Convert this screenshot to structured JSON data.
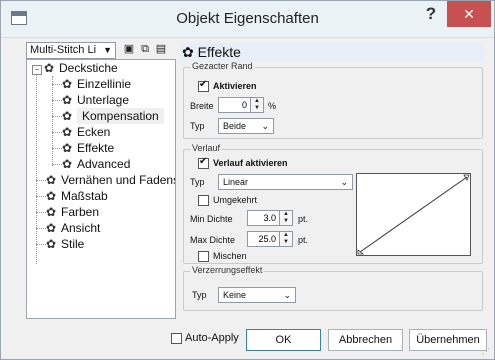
{
  "window": {
    "title": "Objekt Eigenschaften",
    "help_label": "?",
    "close_label": "✕"
  },
  "left": {
    "combo": {
      "value": "Multi-Stitch Li"
    },
    "toolbar_icons": [
      "save-icon",
      "copy-icon",
      "paste-icon"
    ],
    "tree": {
      "root": "Deckstiche",
      "children": [
        "Einzellinie",
        "Unterlage",
        "Kompensation",
        "Ecken",
        "Effekte",
        "Advanced"
      ],
      "others": [
        "Vernähen und Fadens",
        "Maßstab",
        "Farben",
        "Ansicht",
        "Stile"
      ],
      "selected": "Kompensation",
      "expander_glyph": "−"
    }
  },
  "right": {
    "header": "Effekte",
    "gezackter_rand": {
      "legend": "Gezacter Rand",
      "aktivieren_label": "Aktivieren",
      "aktivieren_checked": true,
      "breite_label": "Breite",
      "breite_value": "0",
      "breite_unit": "%",
      "typ_label": "Typ",
      "typ_value": "Beide"
    },
    "verlauf": {
      "legend": "Verlauf",
      "aktivieren_label": "Verlauf aktivieren",
      "aktivieren_checked": true,
      "typ_label": "Typ",
      "typ_value": "Linear",
      "umgekehrt_label": "Umgekehrt",
      "min_label": "Min Dichte",
      "min_value": "3.0",
      "max_label": "Max Dichte",
      "max_value": "25.0",
      "unit": "pt.",
      "mischen_label": "Mischen"
    },
    "verzerrung": {
      "legend": "Verzerrungseffekt",
      "typ_label": "Typ",
      "typ_value": "Keine"
    }
  },
  "bottom": {
    "auto_apply_label": "Auto-Apply",
    "ok_label": "OK",
    "cancel_label": "Abbrechen",
    "apply_label": "Übernehmen"
  },
  "colors": {
    "close": "#c75050",
    "header_bg": "#e8eef7",
    "titlebar": "#eaf2f5"
  }
}
